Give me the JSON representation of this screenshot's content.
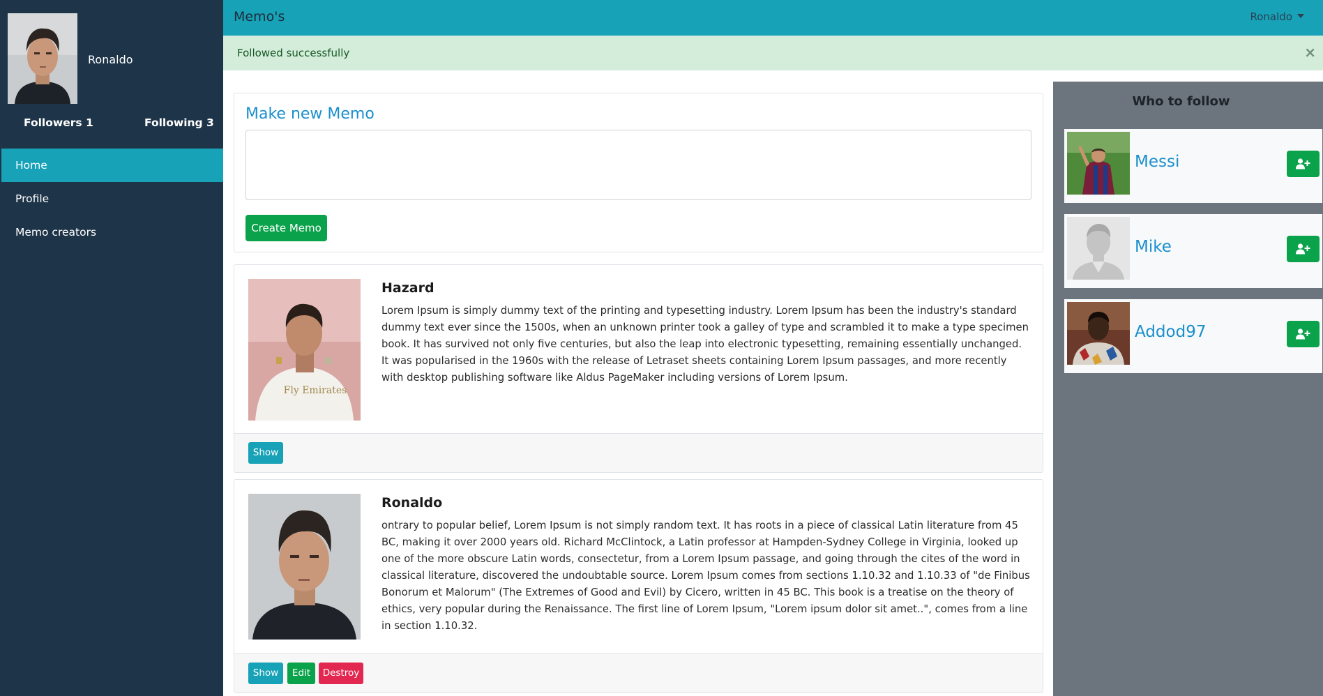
{
  "sidebar": {
    "profile_name": "Ronaldo",
    "followers_label": "Followers 1",
    "following_label": "Following 3",
    "nav": [
      {
        "label": "Home",
        "active": true
      },
      {
        "label": "Profile",
        "active": false
      },
      {
        "label": "Memo creators",
        "active": false
      }
    ]
  },
  "topbar": {
    "title": "Memo's",
    "user_menu": "Ronaldo"
  },
  "alert": {
    "message": "Followed successfully",
    "close_symbol": "×"
  },
  "new_memo": {
    "title": "Make new Memo",
    "textarea_value": "",
    "button_label": "Create Memo"
  },
  "memos": [
    {
      "author": "Hazard",
      "body": "Lorem Ipsum is simply dummy text of the printing and typesetting industry. Lorem Ipsum has been the industry's standard dummy text ever since the 1500s, when an unknown printer took a galley of type and scrambled it to make a type specimen book. It has survived not only five centuries, but also the leap into electronic typesetting, remaining essentially unchanged. It was popularised in the 1960s with the release of Letraset sheets containing Lorem Ipsum passages, and more recently with desktop publishing software like Aldus PageMaker including versions of Lorem Ipsum.",
      "shirt_sponsor": "Fly Emirates",
      "buttons": {
        "show": "Show"
      }
    },
    {
      "author": "Ronaldo",
      "body": "ontrary to popular belief, Lorem Ipsum is not simply random text. It has roots in a piece of classical Latin literature from 45 BC, making it over 2000 years old. Richard McClintock, a Latin professor at Hampden-Sydney College in Virginia, looked up one of the more obscure Latin words, consectetur, from a Lorem Ipsum passage, and going through the cites of the word in classical literature, discovered the undoubtable source. Lorem Ipsum comes from sections 1.10.32 and 1.10.33 of \"de Finibus Bonorum et Malorum\" (The Extremes of Good and Evil) by Cicero, written in 45 BC. This book is a treatise on the theory of ethics, very popular during the Renaissance. The first line of Lorem Ipsum, \"Lorem ipsum dolor sit amet..\", comes from a line in section 1.10.32.",
      "buttons": {
        "show": "Show",
        "edit": "Edit",
        "destroy": "Destroy"
      }
    }
  ],
  "who_to_follow": {
    "title": "Who to follow",
    "users": [
      {
        "name": "Messi",
        "icon": "user-plus-icon"
      },
      {
        "name": "Mike",
        "icon": "user-plus-icon"
      },
      {
        "name": "Addod97",
        "icon": "user-plus-icon"
      }
    ]
  },
  "colors": {
    "sidebar_bg": "#1e3449",
    "accent": "#17a2b8",
    "success": "#0aa24a",
    "danger": "#e22850",
    "link": "#1a8fcd",
    "alert_bg": "#d4edda",
    "panel_bg": "#6c757d"
  }
}
